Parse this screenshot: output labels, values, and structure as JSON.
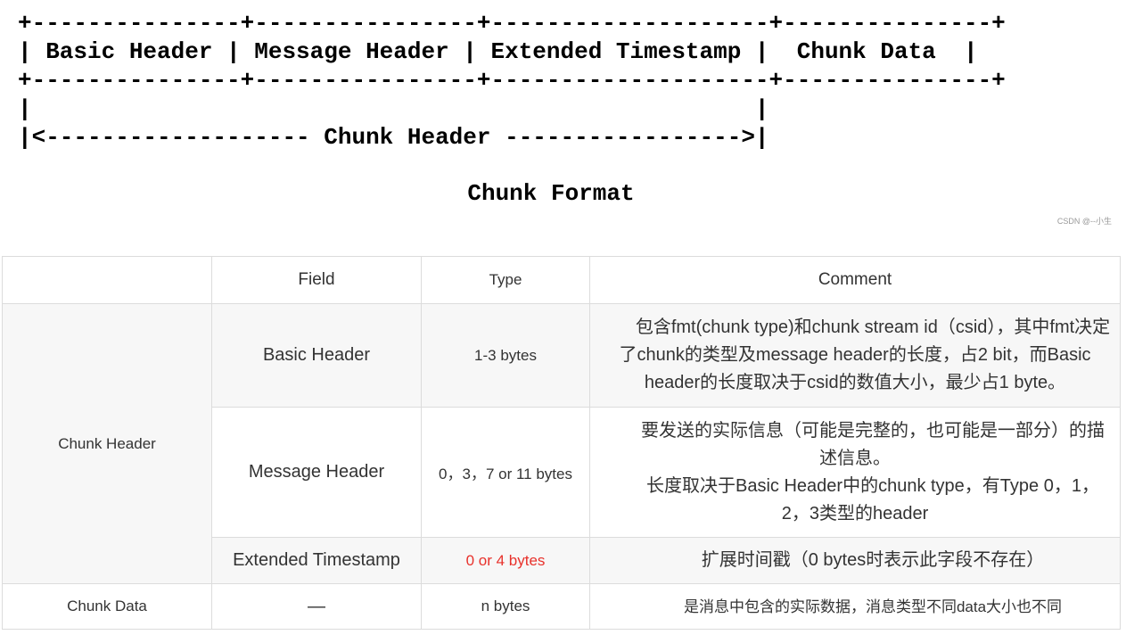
{
  "diagram": {
    "lines": [
      "+---------------+----------------+--------------------+---------------+",
      "| Basic Header | Message Header | Extended Timestamp |  Chunk Data  |",
      "+---------------+----------------+--------------------+---------------+",
      "|                                                    |",
      "|<------------------- Chunk Header ----------------->|"
    ],
    "title": "Chunk Format",
    "watermark": "CSDN @--小生"
  },
  "table": {
    "headers": [
      "",
      "Field",
      "Type",
      "Comment"
    ],
    "group_chunk_header": "Chunk Header",
    "rows": [
      {
        "field": "Basic Header",
        "type": "1-3 bytes",
        "comment": "包含fmt(chunk type)和chunk stream id（csid），其中fmt决定了chunk的类型及message header的长度，占2 bit，而Basic header的长度取决于csid的数值大小，最少占1 byte。"
      },
      {
        "field": "Message Header",
        "type": "0，3，7 or 11 bytes",
        "comment_line1": "要发送的实际信息（可能是完整的，也可能是一部分）的描述信息。",
        "comment_line2": "长度取决于Basic Header中的chunk type，有Type 0，1，2，3类型的header"
      },
      {
        "field": "Extended Timestamp",
        "type": "0 or 4 bytes",
        "type_color": "#e8312b",
        "comment": "扩展时间戳（0 bytes时表示此字段不存在）"
      }
    ],
    "chunk_data": {
      "group": "Chunk Data",
      "field": "—",
      "type": "n bytes",
      "comment": "是消息中包含的实际数据，消息类型不同data大小也不同"
    }
  }
}
